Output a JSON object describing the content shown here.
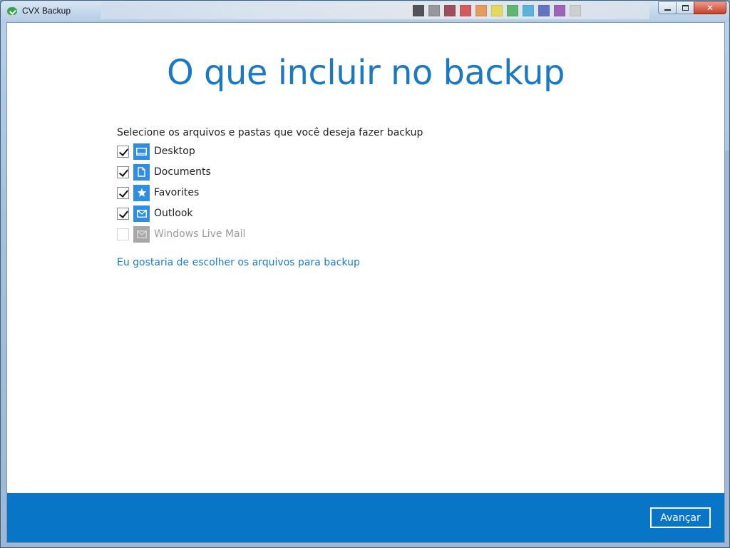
{
  "window": {
    "title": "CVX Backup",
    "close_glyph": "✕"
  },
  "main": {
    "heading": "O que incluir no backup",
    "intro": "Selecione os arquivos e pastas que você deseja fazer backup",
    "items": [
      {
        "label": "Desktop",
        "checked": true,
        "enabled": true,
        "icon": "desktop-icon"
      },
      {
        "label": "Documents",
        "checked": true,
        "enabled": true,
        "icon": "document-icon"
      },
      {
        "label": "Favorites",
        "checked": true,
        "enabled": true,
        "icon": "star-icon"
      },
      {
        "label": "Outlook",
        "checked": true,
        "enabled": true,
        "icon": "mail-icon"
      },
      {
        "label": "Windows Live Mail",
        "checked": false,
        "enabled": false,
        "icon": "mail-icon"
      }
    ],
    "custom_link": "Eu gostaria de escolher os arquivos para backup"
  },
  "footer": {
    "next_label": "Avançar"
  },
  "colors": {
    "accent": "#1b78c2",
    "footer": "#0875c6",
    "icon": "#2f8ee0",
    "icon_disabled": "#a8a8a8"
  }
}
